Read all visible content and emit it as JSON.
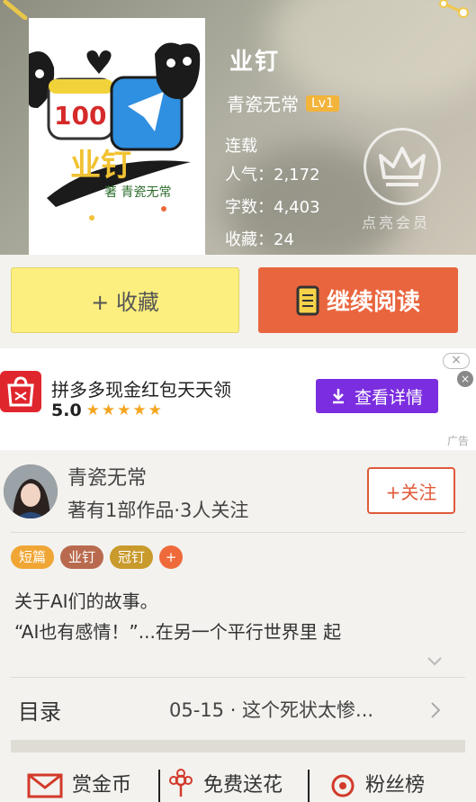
{
  "header": {
    "book_title": "业钉",
    "author": "青瓷无常",
    "level": "Lv1",
    "status": "连载",
    "popularity": "人气：2,172",
    "word_count": "字数：4,403",
    "favorites": "收藏：24",
    "vip_label": "点亮会员"
  },
  "cover": {
    "num": "100",
    "title": "业钉",
    "author_line": "著 青瓷无常"
  },
  "actions": {
    "collect_label": "+ 收藏",
    "read_label": "继续阅读"
  },
  "ad": {
    "title": "拼多多现金红包天天领",
    "rating": "5.0",
    "stars": "★★★★★",
    "button_label": "查看详情",
    "tag": "广告",
    "close": "×"
  },
  "author_card": {
    "name": "青瓷无常",
    "stats": "著有1部作品·3人关注",
    "follow_label": "+关注"
  },
  "tags": [
    {
      "label": "短篇",
      "color": "#f0a634"
    },
    {
      "label": "业钉",
      "color": "#b96a4e"
    },
    {
      "label": "冠钉",
      "color": "#c99a2c"
    },
    {
      "label": "+",
      "color": "#ef6a3a"
    }
  ],
  "synopsis": {
    "line1": "关于AI们的故事。",
    "line2": "“AI也有感情！”...在另一个平行世界里 起"
  },
  "toc": {
    "label": "目录",
    "latest": "05-15 · 这个死状太惨..."
  },
  "bottom_bar": {
    "reward": "赏金币",
    "flower": "免费送花",
    "fans": "粉丝榜"
  },
  "colors": {
    "accent_orange": "#e9653d",
    "collect_yellow": "#fcef7f",
    "ad_purple": "#7b2ee0",
    "level_gold": "#f2b43a"
  }
}
